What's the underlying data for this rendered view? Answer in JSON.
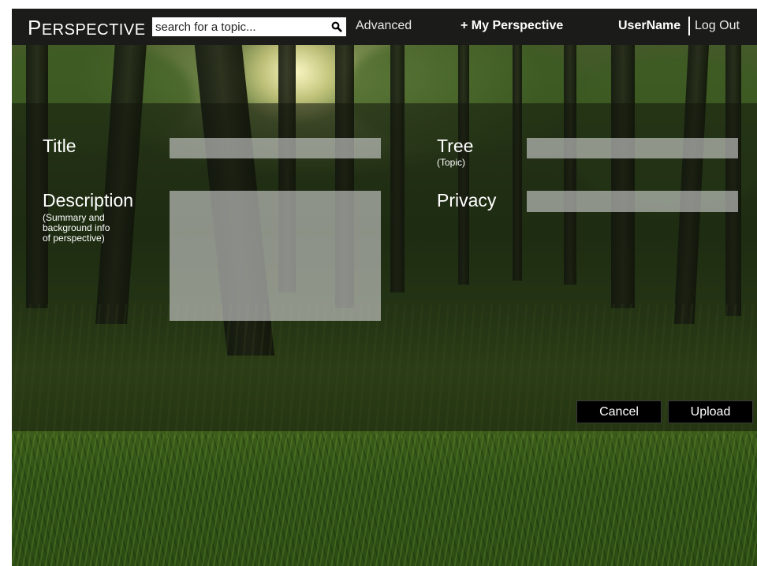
{
  "header": {
    "logo_first": "P",
    "logo_rest": "ERSPECTIVE",
    "search_placeholder": "search for a topic...",
    "advanced_label": "Advanced",
    "my_perspective_label": "+ My Perspective",
    "username": "UserName",
    "logout_label": "Log Out"
  },
  "form": {
    "title_label": "Title",
    "title_value": "",
    "description_label": "Description",
    "description_hint_1": "(Summary and",
    "description_hint_2": "background info",
    "description_hint_3": "of perspective)",
    "description_value": "",
    "tree_label": "Tree",
    "tree_hint": "(Topic)",
    "tree_value": "",
    "privacy_label": "Privacy",
    "privacy_value": ""
  },
  "actions": {
    "cancel_label": "Cancel",
    "upload_label": "Upload"
  },
  "icons": {
    "search": "search-icon"
  },
  "colors": {
    "header_bg": "#1b1c1a",
    "field_bg": "#d7d7d7",
    "button_bg": "#000000",
    "text": "#ffffff"
  }
}
